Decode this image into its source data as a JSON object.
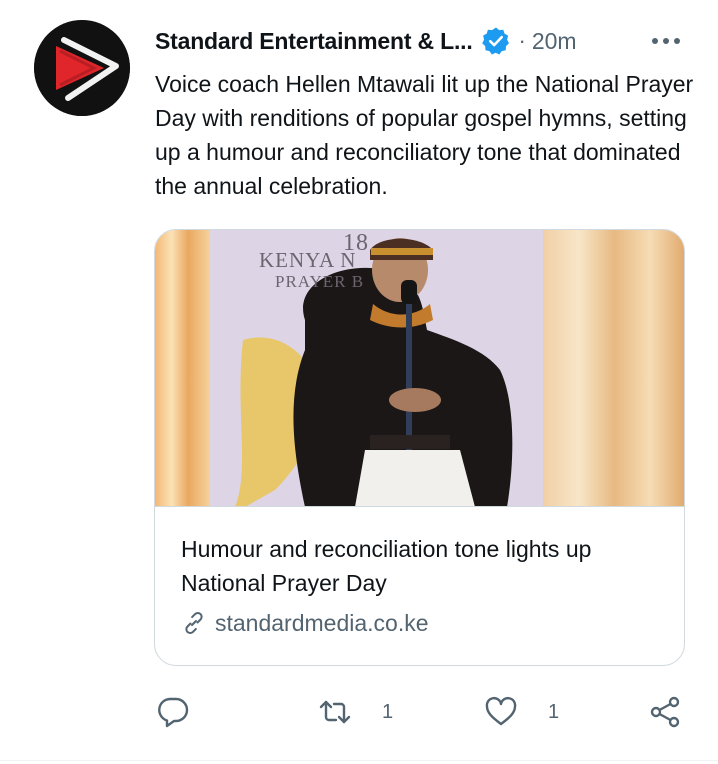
{
  "tweet": {
    "author": {
      "display_name": "Standard Entertainment & L...",
      "verified": true,
      "avatar_icon": "standard-logo-icon"
    },
    "separator": "·",
    "time": "20m",
    "text": "Voice coach Hellen Mtawali lit up the National Prayer Day with renditions of popular gospel hymns, setting up a humour and reconciliatory tone that dominated the annual celebration.",
    "card": {
      "image_banner": {
        "year": "18",
        "line1": "KENYA N",
        "line2": "PRAYER B"
      },
      "title": "Humour and reconciliation tone lights up National Prayer Day",
      "domain": "standardmedia.co.ke"
    },
    "actions": {
      "reply_count": "",
      "retweet_count": "1",
      "like_count": "1"
    }
  },
  "colors": {
    "text_primary": "#0f1419",
    "text_secondary": "#536471",
    "verified_blue": "#1d9bf0",
    "border": "#cfd9de",
    "logo_red": "#e0262b"
  }
}
